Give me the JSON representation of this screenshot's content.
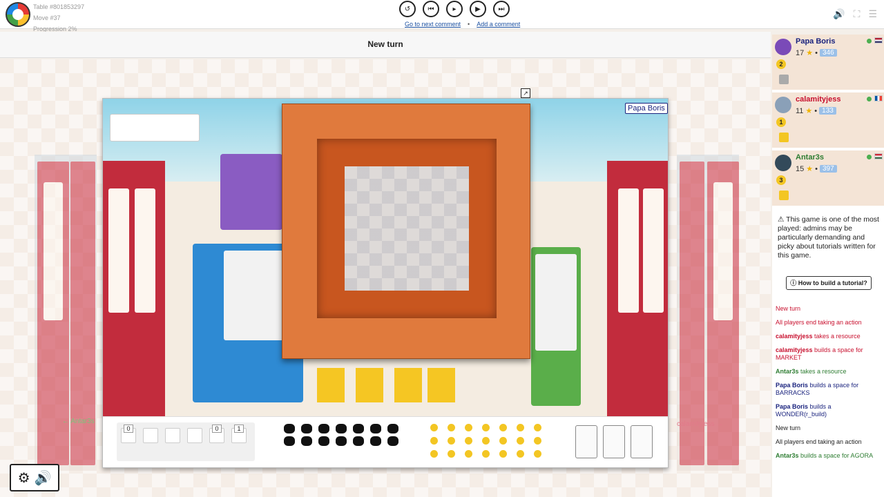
{
  "header": {
    "table": "Table #801853297",
    "move": "Move #37",
    "progression": "Progression 2%",
    "next_comment": "Go to next comment",
    "separator": "•",
    "add_comment": "Add a comment"
  },
  "status": {
    "text": "New turn"
  },
  "board": {
    "player_tag": "Papa Boris",
    "left_player": "← Antar3s",
    "right_player": "calamityjess →",
    "resource_counts": [
      "0",
      "",
      "",
      "",
      "0",
      "1"
    ]
  },
  "players": [
    {
      "name": "Papa Boris",
      "score": "17",
      "elo": "346",
      "token": "2",
      "name_color": "#1a237e",
      "avatar_color": "#7a4ab8"
    },
    {
      "name": "calamityjess",
      "score": "11",
      "elo": "133",
      "token": "1",
      "name_color": "#c8102e",
      "avatar_color": "#8aa0b8"
    },
    {
      "name": "Antar3s",
      "score": "15",
      "elo": "397",
      "token": "3",
      "name_color": "#2e7d32",
      "avatar_color": "#334a5a"
    }
  ],
  "notice": {
    "text": "This game is one of the most played: admins may be particularly demanding and picky about tutorials written for this game.",
    "button": "How to build a tutorial?"
  },
  "log": [
    {
      "player": "",
      "text": "New turn",
      "color": "#c8102e"
    },
    {
      "player": "",
      "text": "All players end taking an action",
      "color": "#c8102e"
    },
    {
      "player": "calamityjess",
      "text": " takes a resource",
      "color": "#c8102e"
    },
    {
      "player": "calamityjess",
      "text": " builds a space for MARKET",
      "color": "#c8102e"
    },
    {
      "player": "Antar3s",
      "text": " takes a resource",
      "color": "#2e7d32"
    },
    {
      "player": "Papa Boris",
      "text": " builds a space for BARRACKS",
      "color": "#1a237e"
    },
    {
      "player": "Papa Boris",
      "text": " builds a WONDER(r_build)",
      "color": "#1a237e"
    },
    {
      "player": "",
      "text": "New turn",
      "color": "#222222"
    },
    {
      "player": "",
      "text": "All players end taking an action",
      "color": "#222222"
    },
    {
      "player": "Antar3s",
      "text": " builds a space for AGORA",
      "color": "#2e7d32"
    }
  ]
}
